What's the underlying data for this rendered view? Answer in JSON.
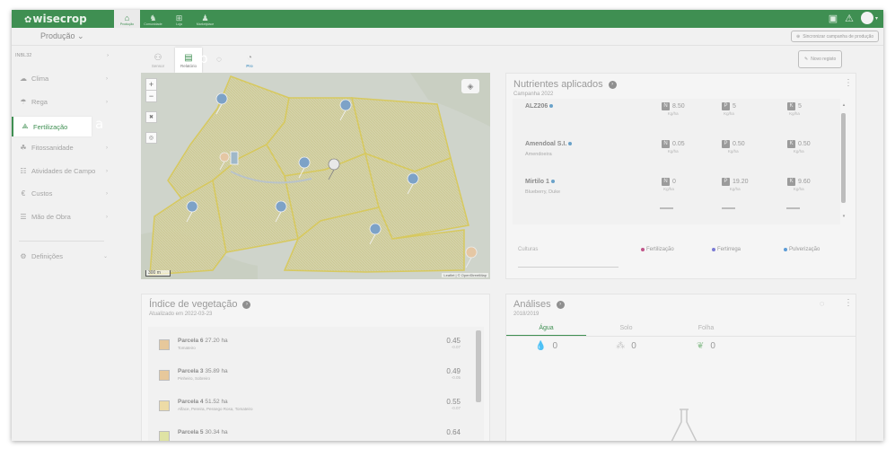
{
  "app": {
    "logo_text": "wisecrop",
    "nav": [
      {
        "label": "Produção",
        "icon": "farm-icon",
        "glyph": "⌂",
        "active": true
      },
      {
        "label": "Comunidade",
        "icon": "community-icon",
        "glyph": "♞",
        "active": false
      },
      {
        "label": "Loja",
        "icon": "store-icon",
        "glyph": "⊞",
        "active": false
      },
      {
        "label": "Marketplace",
        "icon": "marketplace-icon",
        "glyph": "♟",
        "active": false
      }
    ],
    "production_selector": "Produção",
    "sync_button": "Sincronizar campanha de produção"
  },
  "sidebar": {
    "farm": "INBL32",
    "items": [
      {
        "label": "Clima",
        "icon": "cloud-icon",
        "glyph": "☁"
      },
      {
        "label": "Rega",
        "icon": "irrigation-icon",
        "glyph": "☂"
      },
      {
        "label": "Fertilização",
        "icon": "fertilization-icon",
        "glyph": "⟁",
        "active": true
      },
      {
        "label": "Fitossanidade",
        "icon": "plant-health-icon",
        "glyph": "☘"
      },
      {
        "label": "Atividades de Campo",
        "icon": "field-activities-icon",
        "glyph": "☷"
      },
      {
        "label": "Custos",
        "icon": "costs-icon",
        "glyph": "€"
      },
      {
        "label": "Mão de Obra",
        "icon": "labor-icon",
        "glyph": "☰"
      },
      {
        "label": "Definições",
        "icon": "settings-icon",
        "glyph": "⚙"
      }
    ]
  },
  "annotations": {
    "a": "a",
    "b": "b"
  },
  "map_toolbar": {
    "tools": [
      {
        "label": "Sensor",
        "icon": "sensor-icon",
        "glyph": "⚇"
      },
      {
        "label": "Relatório",
        "icon": "report-icon",
        "glyph": "▤",
        "highlight": true
      },
      {
        "label": "",
        "icon": "tool-icon",
        "glyph": "◌"
      },
      {
        "label": "Pro",
        "icon": "pro-icon",
        "glyph": "◔",
        "pro": true
      }
    ],
    "new_record": "Novo registo"
  },
  "map": {
    "scale": "300 m",
    "attribution": "Leaflet | © OpenStreetMap"
  },
  "nutrients": {
    "title": "Nutrientes aplicados",
    "subtitle": "Campanha 2022",
    "rows": [
      {
        "name": "ALZ206",
        "crop": "",
        "values": [
          {
            "n": "N",
            "v": "8.50",
            "u": "Kg/ha"
          },
          {
            "n": "P",
            "v": "5",
            "u": "Kg/ha"
          },
          {
            "n": "K",
            "v": "5",
            "u": "Kg/ha"
          }
        ]
      },
      {
        "name": "Amendoal S.I.",
        "crop": "Amendoeira",
        "values": [
          {
            "n": "N",
            "v": "0.05",
            "u": "Kg/ha"
          },
          {
            "n": "P",
            "v": "0.50",
            "u": "Kg/ha"
          },
          {
            "n": "K",
            "v": "0.50",
            "u": "Kg/ha"
          }
        ]
      },
      {
        "name": "Mirtilo 1",
        "crop": "Blueberry, Duke",
        "values": [
          {
            "n": "N",
            "v": "0",
            "u": "Kg/ha"
          },
          {
            "n": "P",
            "v": "19.20",
            "u": "Kg/ha"
          },
          {
            "n": "K",
            "v": "9.60",
            "u": "Kg/ha"
          }
        ]
      }
    ],
    "culture_label": "Culturas",
    "legend": [
      {
        "label": "Fertilização",
        "color": "#c0558a"
      },
      {
        "label": "Fertirrega",
        "color": "#7b7bd4"
      },
      {
        "label": "Pulverização",
        "color": "#5d9cd6"
      }
    ]
  },
  "vegetation": {
    "title": "Índice de vegetação",
    "subtitle": "Atualizado em 2022-03-23",
    "rows": [
      {
        "name": "Parcela 6",
        "area": "27.20 ha",
        "crop": "Tomateiro",
        "value": "0.45",
        "delta": "-0.07",
        "color": "#e7c89b"
      },
      {
        "name": "Parcela 3",
        "area": "35.89 ha",
        "crop": "Pinheiro, Sobreiro",
        "value": "0.49",
        "delta": "-0.05",
        "color": "#e7c89b"
      },
      {
        "name": "Parcela 4",
        "area": "51.52 ha",
        "crop": "Alface, Pereira, Pessego Rosa, Tomateiro",
        "value": "0.55",
        "delta": "-0.07",
        "color": "#eddba6"
      },
      {
        "name": "Parcela 5",
        "area": "30.34 ha",
        "crop": "",
        "value": "0.64",
        "delta": "",
        "color": "#dfe3a4"
      }
    ]
  },
  "analysis": {
    "title": "Análises",
    "subtitle": "2018/2019",
    "tabs": [
      {
        "label": "Água",
        "icon": "water-drop-icon",
        "glyph": "💧",
        "value": "0",
        "active": true
      },
      {
        "label": "Solo",
        "icon": "soil-icon",
        "glyph": "⁂",
        "value": "0"
      },
      {
        "label": "Folha",
        "icon": "leaf-icon",
        "glyph": "❦",
        "value": "0"
      }
    ]
  }
}
